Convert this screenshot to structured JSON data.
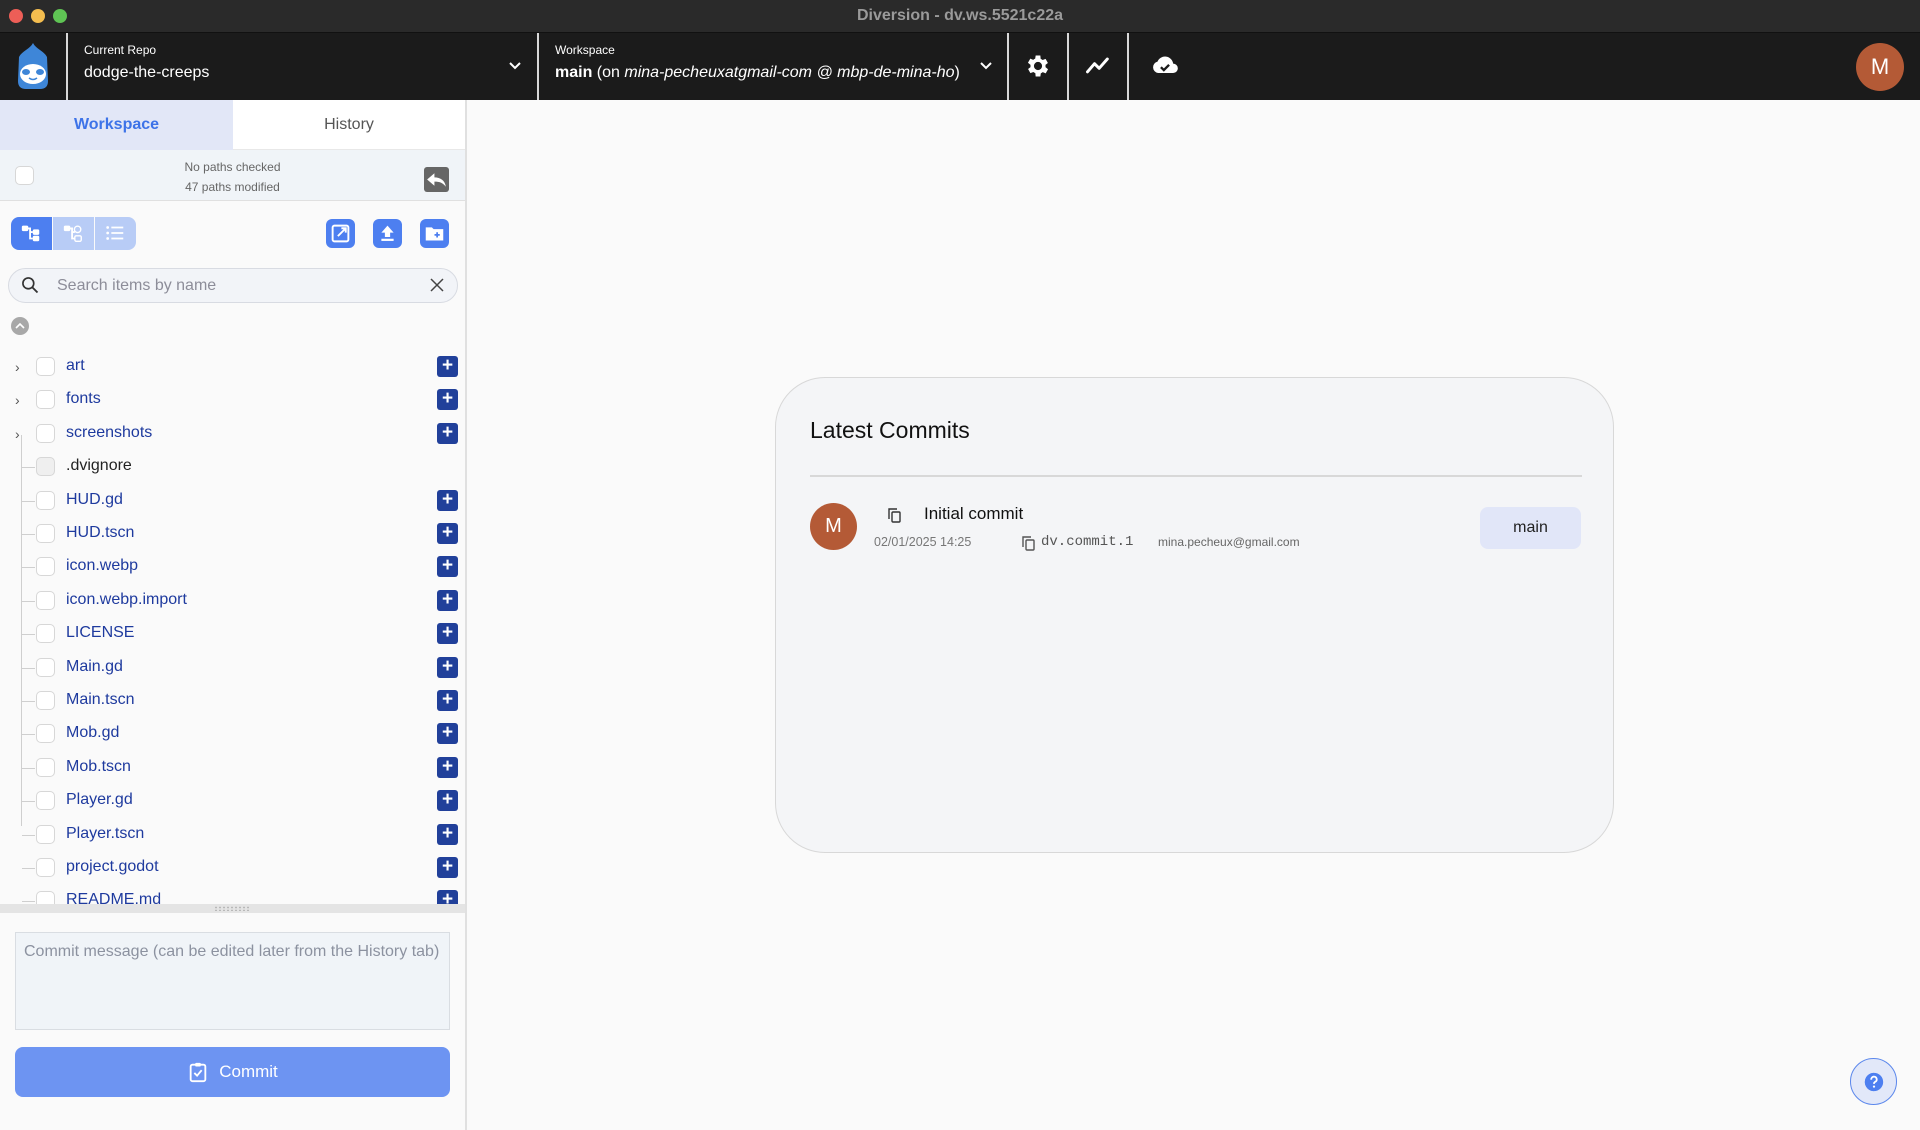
{
  "window": {
    "title": "Diversion - dv.ws.5521c22a"
  },
  "header": {
    "repo": {
      "label": "Current Repo",
      "value": "dodge-the-creeps"
    },
    "workspace": {
      "label": "Workspace",
      "branch": "main",
      "detail_prefix": " (on ",
      "detail_user": "mina-pecheuxatgmail-com @ mbp-de-mina-ho",
      "detail_suffix": ")"
    },
    "icons": [
      "gear-icon",
      "analytics-icon",
      "cloud-check-icon"
    ],
    "user_initial": "M"
  },
  "sidebar": {
    "tabs": [
      {
        "label": "Workspace",
        "active": true
      },
      {
        "label": "History",
        "active": false
      }
    ],
    "status": {
      "checked": "No paths checked",
      "modified": "47 paths modified"
    },
    "search": {
      "placeholder": "Search items by name",
      "value": ""
    },
    "tree": [
      {
        "name": "art",
        "type": "folder",
        "ignored": false
      },
      {
        "name": "fonts",
        "type": "folder",
        "ignored": false
      },
      {
        "name": "screenshots",
        "type": "folder",
        "ignored": false
      },
      {
        "name": ".dvignore",
        "type": "file",
        "ignored": true
      },
      {
        "name": "HUD.gd",
        "type": "file",
        "ignored": false
      },
      {
        "name": "HUD.tscn",
        "type": "file",
        "ignored": false
      },
      {
        "name": "icon.webp",
        "type": "file",
        "ignored": false
      },
      {
        "name": "icon.webp.import",
        "type": "file",
        "ignored": false
      },
      {
        "name": "LICENSE",
        "type": "file",
        "ignored": false
      },
      {
        "name": "Main.gd",
        "type": "file",
        "ignored": false
      },
      {
        "name": "Main.tscn",
        "type": "file",
        "ignored": false
      },
      {
        "name": "Mob.gd",
        "type": "file",
        "ignored": false
      },
      {
        "name": "Mob.tscn",
        "type": "file",
        "ignored": false
      },
      {
        "name": "Player.gd",
        "type": "file",
        "ignored": false
      },
      {
        "name": "Player.tscn",
        "type": "file",
        "ignored": false
      },
      {
        "name": "project.godot",
        "type": "file",
        "ignored": false
      },
      {
        "name": "README.md",
        "type": "file",
        "ignored": false
      }
    ],
    "commit": {
      "placeholder": "Commit message (can be edited later from the History tab)",
      "value": "",
      "button_label": "Commit"
    }
  },
  "main": {
    "card_title": "Latest Commits",
    "commits": [
      {
        "author_initial": "M",
        "message": "Initial commit",
        "date": "02/01/2025 14:25",
        "id": "dv.commit.1",
        "email": "mina.pecheux@gmail.com",
        "branch": "main"
      }
    ]
  },
  "colors": {
    "accent": "#4d7ff0",
    "avatar": "#b45a36",
    "add_button": "#21409a",
    "file_name": "#1e3a9e",
    "header_bg": "#1b1b1b"
  }
}
